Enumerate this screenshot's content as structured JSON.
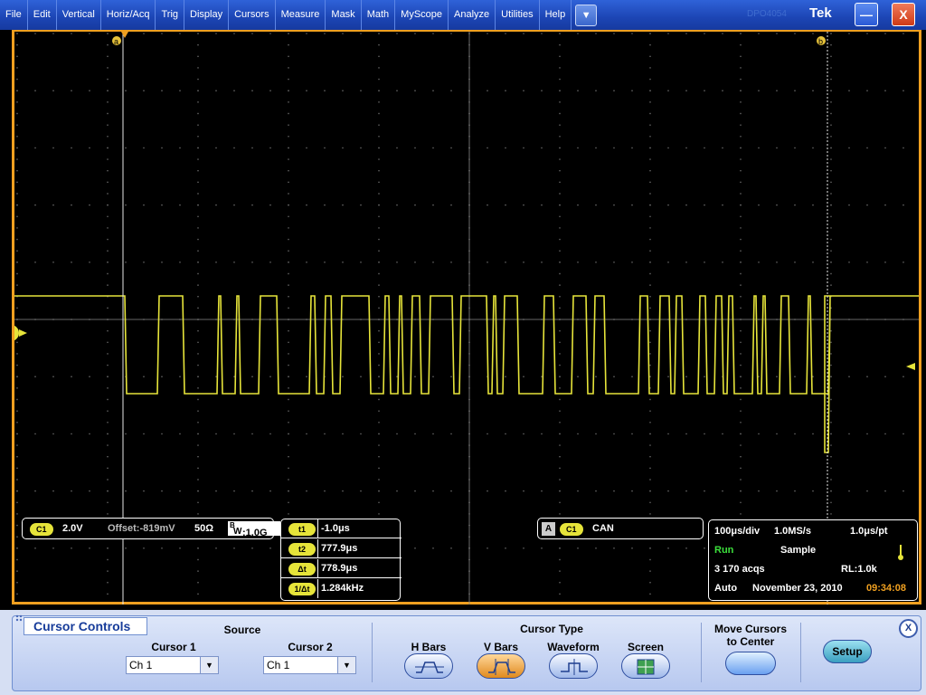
{
  "menubar": {
    "items": [
      "File",
      "Edit",
      "Vertical",
      "Horiz/Acq",
      "Trig",
      "Display",
      "Cursors",
      "Measure",
      "Mask",
      "Math",
      "MyScope",
      "Analyze",
      "Utilities",
      "Help"
    ],
    "dropdown": "▼",
    "brand_faint": "DPO4054",
    "brand": "Tek",
    "minimize": "—",
    "close": "X"
  },
  "screen": {
    "cursor_a_label": "a",
    "cursor_b_label": "b",
    "ch1_marker": "1",
    "trace_color": "#e6e43a",
    "border_color": "#f0a020"
  },
  "channel_readout": {
    "channel": "C1",
    "scale": "2.0V",
    "offset": "Offset:-819mV",
    "impedance": "50Ω",
    "bw_prefix": "B",
    "bw_sub": "W",
    "bandwidth": ":1.0G"
  },
  "cursor_readouts": [
    {
      "label": "t1",
      "value": "-1.0μs"
    },
    {
      "label": "t2",
      "value": "777.9μs"
    },
    {
      "label": "Δt",
      "value": "778.9μs"
    },
    {
      "label": "1/Δt",
      "value": "1.284kHz"
    }
  ],
  "trigger_readout": {
    "mode": "A",
    "source": "C1",
    "type": "CAN"
  },
  "acquisition": {
    "time_per_div": "100μs/div",
    "sample_rate": "1.0MS/s",
    "time_per_pt": "1.0μs/pt",
    "state": "Run",
    "mode": "Sample",
    "acqs": "3 170 acqs",
    "record_length": "RL:1.0k",
    "trigger_mode": "Auto",
    "date": "November 23, 2010",
    "time": "09:34:08"
  },
  "cursor_controls": {
    "title": "Cursor Controls",
    "source_label": "Source",
    "cursor1_label": "Cursor 1",
    "cursor1_value": "Ch 1",
    "cursor2_label": "Cursor 2",
    "cursor2_value": "Ch 1",
    "cursor_type_label": "Cursor Type",
    "types": [
      "H Bars",
      "V Bars",
      "Waveform",
      "Screen"
    ],
    "selected_type": "V Bars",
    "move_to_center_label": "Move Cursors to Center",
    "setup_label": "Setup",
    "close_label": "X"
  }
}
